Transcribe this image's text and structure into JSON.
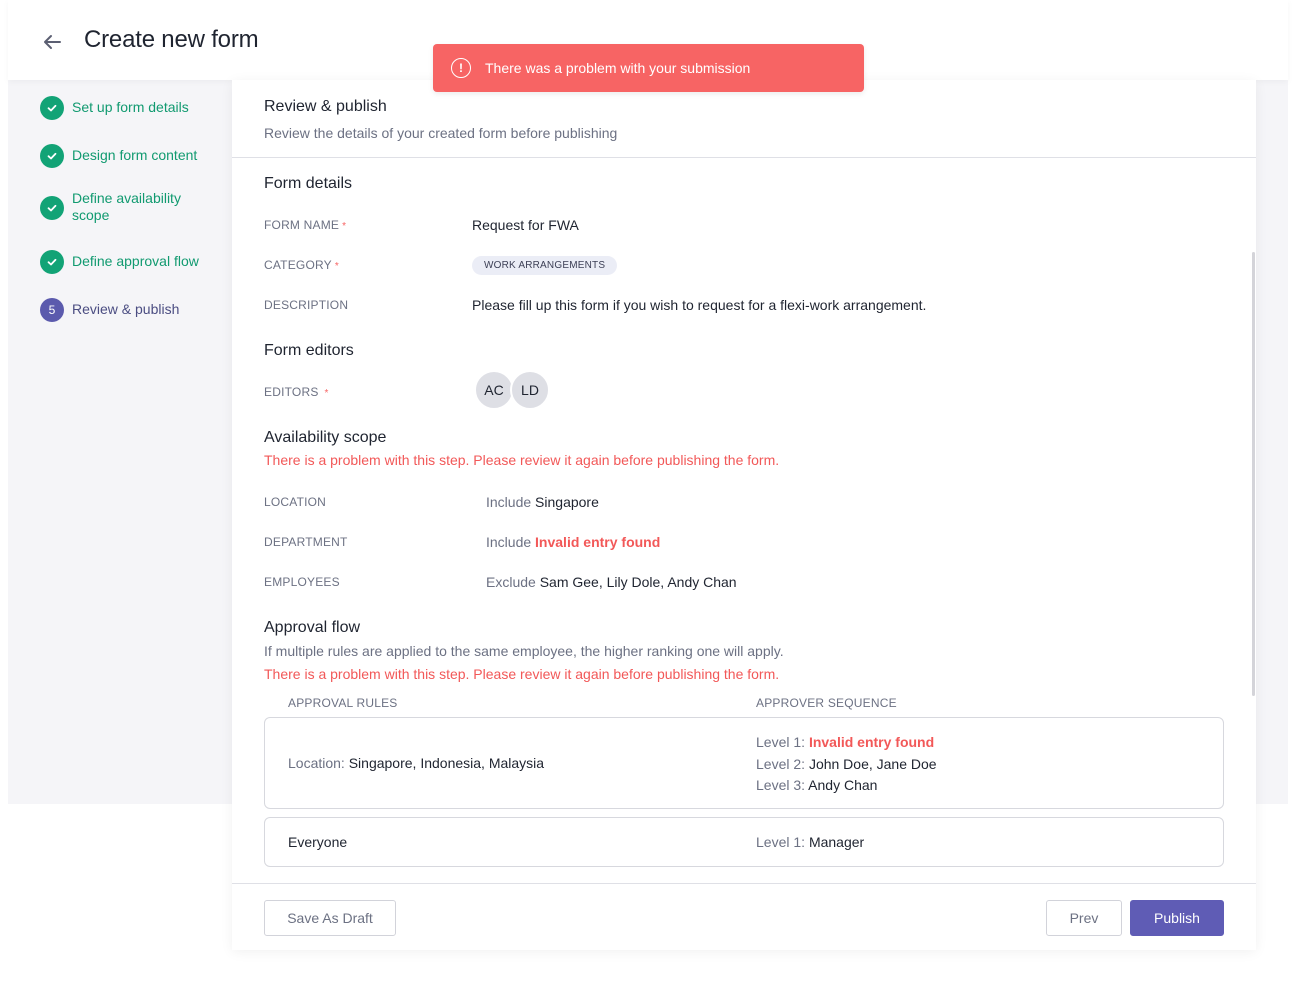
{
  "header": {
    "title": "Create new form",
    "back_icon": "arrow-left-icon"
  },
  "toast": {
    "icon": "exclamation-circle-icon",
    "message": "There was a problem with your submission",
    "color": "#f76464"
  },
  "stepper": [
    {
      "label": "Set up form details",
      "status": "done"
    },
    {
      "label": "Design form content",
      "status": "done"
    },
    {
      "label": "Define availability scope",
      "status": "done"
    },
    {
      "label": "Define approval flow",
      "status": "done"
    },
    {
      "label": "Review & publish",
      "status": "current",
      "number": "5"
    }
  ],
  "review": {
    "title": "Review & publish",
    "subtitle": "Review the details of your created form before publishing"
  },
  "form_details": {
    "title": "Form details",
    "name_label": "FORM NAME",
    "name_value": "Request for FWA",
    "category_label": "CATEGORY",
    "category_value": "WORK ARRANGEMENTS",
    "description_label": "DESCRIPTION",
    "description_value": "Please fill up this form if you wish to request for a flexi-work arrangement.",
    "required_mark": "*"
  },
  "form_editors": {
    "title": "Form editors",
    "editors_label": "EDITORS",
    "editors": [
      "AC",
      "LD"
    ]
  },
  "availability": {
    "title": "Availability scope",
    "error": "There is a problem with this step. Please review it again before publishing the form.",
    "location_label": "LOCATION",
    "location_mode": "Include",
    "location_value": "Singapore",
    "department_label": "DEPARTMENT",
    "department_mode": "Include",
    "department_value": "Invalid entry found",
    "employees_label": "EMPLOYEES",
    "employees_mode": "Exclude",
    "employees_value": "Sam Gee, Lily Dole, Andy Chan"
  },
  "approval": {
    "title": "Approval flow",
    "note": "If multiple rules are applied to the same employee, the higher ranking one will apply.",
    "error": "There is a problem with this step. Please review it again before publishing the form.",
    "rules_header": "APPROVAL RULES",
    "sequence_header": "APPROVER SEQUENCE",
    "rule1": {
      "key": "Location:",
      "value": "Singapore, Indonesia, Malaysia",
      "levels": [
        {
          "label": "Level 1:",
          "value": "Invalid entry found",
          "invalid": true
        },
        {
          "label": "Level 2:",
          "value": "John Doe, Jane Doe",
          "invalid": false
        },
        {
          "label": "Level 3:",
          "value": "Andy Chan",
          "invalid": false
        }
      ]
    },
    "rule2": {
      "value": "Everyone",
      "levels": [
        {
          "label": "Level 1:",
          "value": "Manager",
          "invalid": false
        }
      ]
    }
  },
  "footer": {
    "save_draft": "Save As Draft",
    "prev": "Prev",
    "publish": "Publish"
  },
  "colors": {
    "success": "#12a376",
    "primary": "#5f5cb5",
    "danger": "#f25858"
  }
}
